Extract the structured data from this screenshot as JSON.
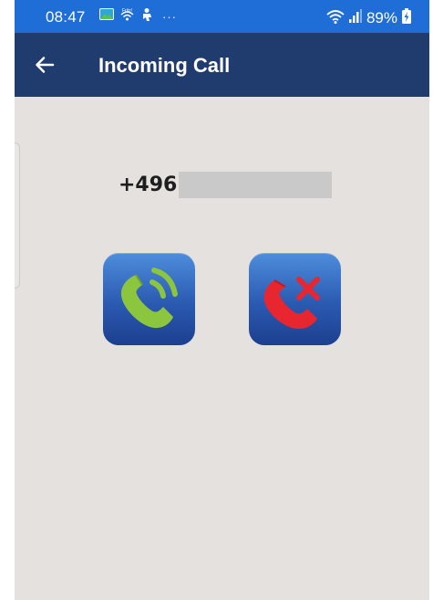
{
  "status_bar": {
    "time": "08:47",
    "battery_percent": "89%",
    "dots": "···",
    "icons": [
      "gallery-icon",
      "fritz-wifi-icon",
      "person-icon",
      "wifi-icon",
      "signal-icon",
      "battery-charging-icon"
    ],
    "background": "#1f6dd6"
  },
  "app_bar": {
    "title": "Incoming Call",
    "back_icon": "arrow-left-icon",
    "background": "#203c6f"
  },
  "caller": {
    "number_prefix": "+496"
  },
  "actions": {
    "accept_icon": "phone-accept-icon",
    "decline_icon": "phone-decline-icon",
    "accept_color": "#8cc63f",
    "decline_color": "#e8262f"
  },
  "colors": {
    "screen_background": "#e4e1de",
    "button_gradient_top": "#4e8ddc",
    "button_gradient_bottom": "#1d3f8f"
  }
}
